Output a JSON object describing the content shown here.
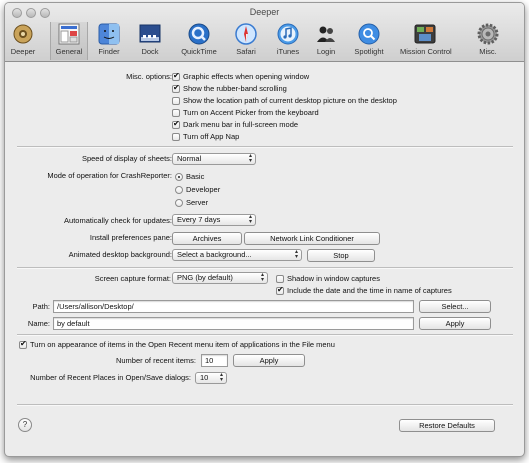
{
  "window": {
    "title": "Deeper"
  },
  "toolbar": {
    "items": [
      {
        "label": "Deeper",
        "icon": "gear-wheel-icon"
      },
      {
        "label": "General",
        "icon": "general-prefs-icon"
      },
      {
        "label": "Finder",
        "icon": "finder-icon"
      },
      {
        "label": "Dock",
        "icon": "dock-icon"
      },
      {
        "label": "QuickTime",
        "icon": "quicktime-icon"
      },
      {
        "label": "Safari",
        "icon": "safari-compass-icon"
      },
      {
        "label": "iTunes",
        "icon": "itunes-note-icon"
      },
      {
        "label": "Login",
        "icon": "users-icon"
      },
      {
        "label": "Spotlight",
        "icon": "spotlight-magnifier-icon"
      },
      {
        "label": "Mission Control",
        "icon": "mission-control-icon"
      },
      {
        "label": "Misc.",
        "icon": "gear-icon"
      }
    ],
    "selected": "General"
  },
  "misc": {
    "label": "Misc. options:",
    "options": [
      {
        "label": "Graphic effects when opening window",
        "checked": true
      },
      {
        "label": "Show the rubber-band scrolling",
        "checked": true
      },
      {
        "label": "Show the location path of current desktop picture on the desktop",
        "checked": false
      },
      {
        "label": "Turn on Accent Picker from the keyboard",
        "checked": false
      },
      {
        "label": "Dark menu bar in full-screen mode",
        "checked": true
      },
      {
        "label": "Turn off App Nap",
        "checked": false
      }
    ]
  },
  "sheets": {
    "label": "Speed of display of sheets:",
    "value": "Normal"
  },
  "crash": {
    "label": "Mode of operation for CrashReporter:",
    "options": [
      {
        "label": "Basic",
        "selected": true
      },
      {
        "label": "Developer",
        "selected": false
      },
      {
        "label": "Server",
        "selected": false
      }
    ]
  },
  "updates": {
    "label": "Automatically check for updates:",
    "value": "Every 7 days"
  },
  "prefpane": {
    "label": "Install preferences pane:",
    "archives": "Archives",
    "nlc": "Network Link Conditioner"
  },
  "background": {
    "label": "Animated desktop background:",
    "value": "Select a background...",
    "stop": "Stop"
  },
  "capture": {
    "format_label": "Screen capture format:",
    "format_value": "PNG (by default)",
    "shadow_label": "Shadow in window captures",
    "shadow_checked": false,
    "date_label": "Include the date and the time in name of captures",
    "date_checked": true,
    "path_label": "Path:",
    "path_value": "/Users/allison/Desktop/",
    "select_button": "Select...",
    "name_label": "Name:",
    "name_value": "by default",
    "apply_button": "Apply"
  },
  "recent": {
    "toggle_label": "Turn on appearance of items in the Open Recent menu item of applications in the File menu",
    "toggle_checked": true,
    "items_label": "Number of recent items:",
    "items_value": "10",
    "apply_button": "Apply",
    "places_label": "Number of Recent Places in Open/Save dialogs:",
    "places_value": "10"
  },
  "footer": {
    "help": "?",
    "restore": "Restore Defaults"
  }
}
